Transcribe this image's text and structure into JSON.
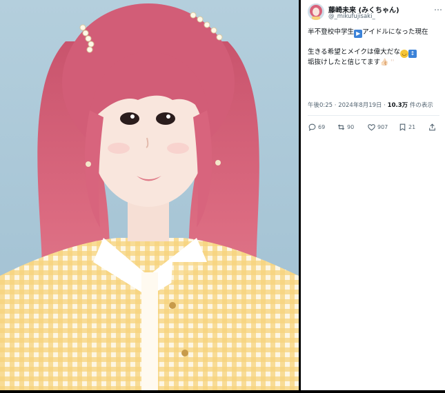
{
  "account": {
    "display_name": "藤崎未来 (みくちゃん)",
    "handle": "@_mikufujisaki_"
  },
  "post": {
    "line1": "半不登校中学生",
    "line1_emoji": "▶",
    "line1_rest": "アイドルになった現在",
    "line2": "生きる希望とメイクは偉大だな",
    "line2_emoji1": "🙂",
    "line2_emoji2": "↕",
    "line3": "垢抜けしたと信じてます",
    "line3_tail": "👍🏻 ''"
  },
  "meta": {
    "timestamp": "午後0:25 · 2024年8月19日 · ",
    "views_count": "10.3万",
    "views_label": " 件の表示"
  },
  "actions": {
    "replies": "69",
    "reposts": "90",
    "likes": "907",
    "bookmarks": "21"
  },
  "icons": {
    "more": "more-dots-icon",
    "reply": "reply-icon",
    "repost": "repost-icon",
    "like": "heart-icon",
    "bookmark": "bookmark-icon",
    "share": "share-icon"
  },
  "colors": {
    "text": "#0f1419",
    "secondary": "#536471",
    "background_photo": "#a9c7d8",
    "hair": "#d9627a"
  }
}
